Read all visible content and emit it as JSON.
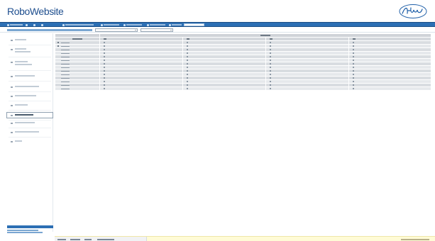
{
  "header": {
    "title_prefix": "",
    "title_name": "RoboWebsite",
    "subtitle": ""
  },
  "toolbar": {
    "items": [
      {
        "label": "",
        "icon": "user-icon"
      },
      {
        "label": "",
        "icon": "folder-icon"
      },
      {
        "label": "",
        "icon": "globe-icon"
      },
      {
        "label": "",
        "icon": "document-icon"
      },
      {
        "label": "",
        "icon": "list-icon"
      },
      {
        "label": "",
        "icon": "grid-icon"
      },
      {
        "label": "",
        "icon": "gear-icon"
      },
      {
        "label": "",
        "icon": "help-icon"
      },
      {
        "label": "",
        "icon": "search-icon"
      }
    ],
    "search_value": "",
    "search_placeholder": ""
  },
  "toolbar2": {
    "breadcrumb": "",
    "select_1": "",
    "select_2": ""
  },
  "sidebar": {
    "items": [
      {
        "label": "",
        "active": false
      },
      {
        "label": "",
        "active": false
      },
      {
        "label": "",
        "active": false
      },
      {
        "label": "",
        "active": false
      },
      {
        "label": "",
        "active": false
      },
      {
        "label": "",
        "active": false
      },
      {
        "label": "",
        "active": false
      },
      {
        "label": "",
        "active": true
      },
      {
        "label": "",
        "active": false
      },
      {
        "label": "",
        "active": false
      },
      {
        "label": "",
        "active": false
      }
    ],
    "footer_title": "",
    "footer_link_1": "",
    "footer_link_2": ""
  },
  "table": {
    "group_header": "",
    "row_header": "",
    "columns": [
      "",
      "",
      "",
      ""
    ],
    "rows": [
      {
        "label": "",
        "cells": [
          "",
          "",
          "",
          ""
        ]
      },
      {
        "label": "",
        "cells": [
          "",
          "",
          "",
          ""
        ]
      },
      {
        "label": "",
        "cells": [
          "",
          "",
          "",
          ""
        ]
      },
      {
        "label": "",
        "cells": [
          "",
          "",
          "",
          ""
        ]
      },
      {
        "label": "",
        "cells": [
          "",
          "",
          "",
          ""
        ]
      },
      {
        "label": "",
        "cells": [
          "",
          "",
          "",
          ""
        ]
      },
      {
        "label": "",
        "cells": [
          "",
          "",
          "",
          ""
        ]
      },
      {
        "label": "",
        "cells": [
          "",
          "",
          "",
          ""
        ]
      },
      {
        "label": "",
        "cells": [
          "",
          "",
          "",
          ""
        ]
      },
      {
        "label": "",
        "cells": [
          "",
          "",
          "",
          ""
        ]
      },
      {
        "label": "",
        "cells": [
          "",
          "",
          "",
          ""
        ]
      },
      {
        "label": "",
        "cells": [
          "",
          "",
          "",
          ""
        ]
      },
      {
        "label": "",
        "cells": [
          "",
          "",
          "",
          ""
        ]
      },
      {
        "label": "",
        "cells": [
          "",
          "",
          "",
          ""
        ]
      }
    ]
  },
  "statusbar": {
    "items": [
      "",
      "",
      "",
      ""
    ],
    "right_text": ""
  },
  "colors": {
    "brand_blue": "#2c6fb4",
    "title_blue": "#1f5fa8",
    "grid_gray": "#d9dde1",
    "status_yellow": "#fffbd6"
  }
}
